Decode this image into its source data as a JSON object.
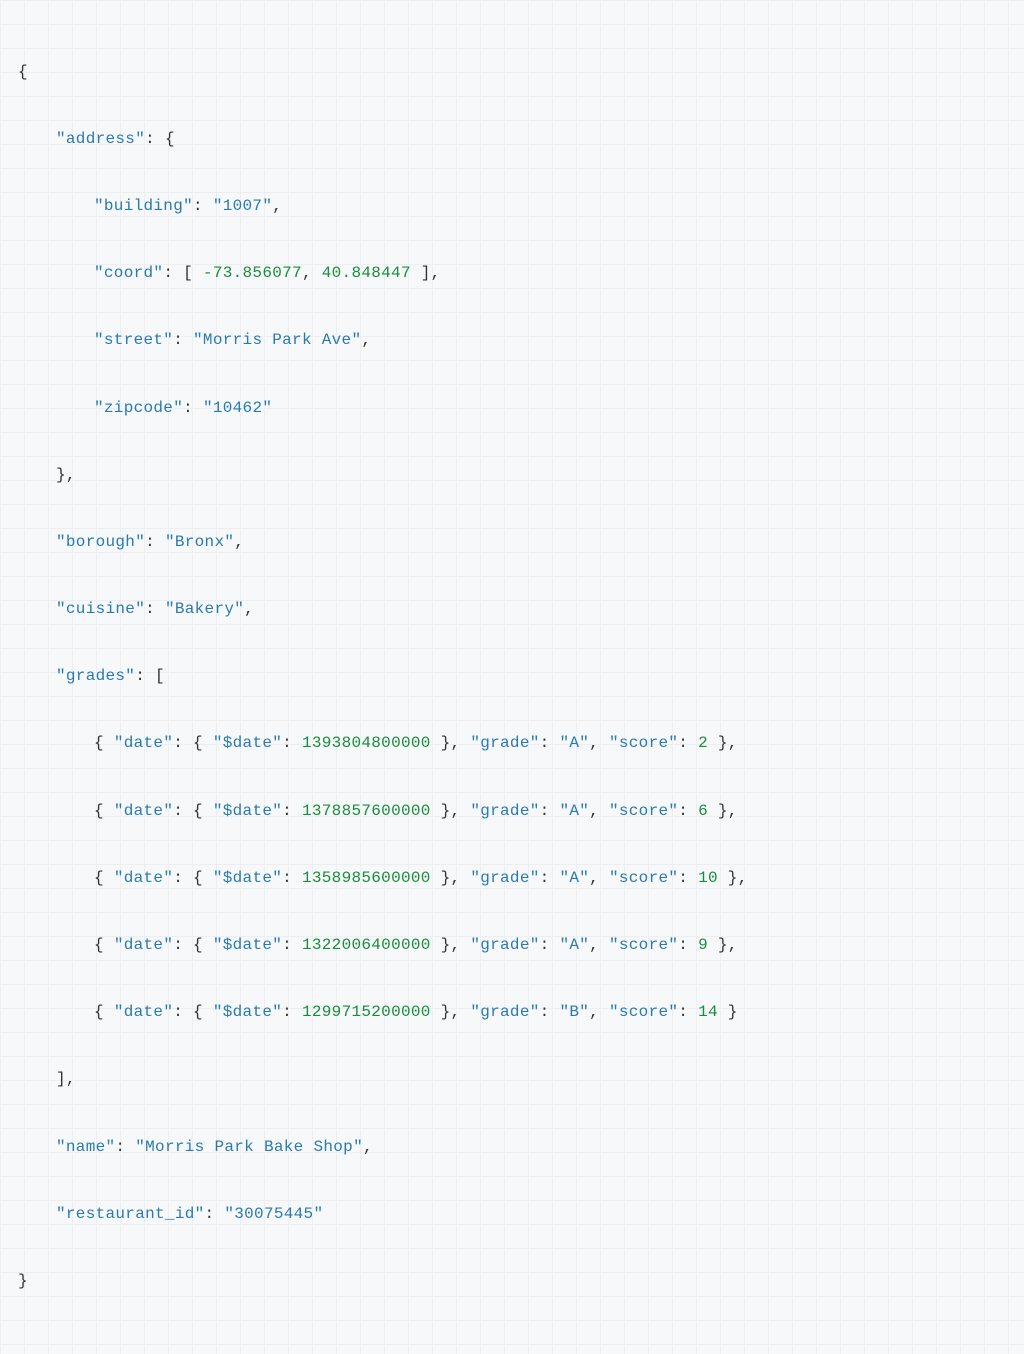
{
  "json_document": {
    "address": {
      "building": "1007",
      "coord": [
        -73.856077,
        40.848447
      ],
      "street": "Morris Park Ave",
      "zipcode": "10462"
    },
    "borough": "Bronx",
    "cuisine": "Bakery",
    "grades": [
      {
        "date": {
          "$date": 1393804800000
        },
        "grade": "A",
        "score": 2
      },
      {
        "date": {
          "$date": 1378857600000
        },
        "grade": "A",
        "score": 6
      },
      {
        "date": {
          "$date": 1358985600000
        },
        "grade": "A",
        "score": 10
      },
      {
        "date": {
          "$date": 1322006400000
        },
        "grade": "A",
        "score": 9
      },
      {
        "date": {
          "$date": 1299715200000
        },
        "grade": "B",
        "score": 14
      }
    ],
    "name": "Morris Park Bake Shop",
    "restaurant_id": "30075445"
  },
  "tokens": {
    "open_brace": "{",
    "close_brace": "}",
    "open_bracket": "[",
    "close_bracket": "]",
    "comma": ",",
    "colon": ":",
    "keys": {
      "address": "\"address\"",
      "building": "\"building\"",
      "coord": "\"coord\"",
      "street": "\"street\"",
      "zipcode": "\"zipcode\"",
      "borough": "\"borough\"",
      "cuisine": "\"cuisine\"",
      "grades": "\"grades\"",
      "date": "\"date\"",
      "dollar_date": "\"$date\"",
      "grade": "\"grade\"",
      "score": "\"score\"",
      "name": "\"name\"",
      "restaurant_id": "\"restaurant_id\""
    },
    "values": {
      "building": "\"1007\"",
      "coord0": "-73.856077",
      "coord1": "40.848447",
      "street": "\"Morris Park Ave\"",
      "zipcode": "\"10462\"",
      "borough": "\"Bronx\"",
      "cuisine": "\"Bakery\"",
      "date0": "1393804800000",
      "date1": "1378857600000",
      "date2": "1358985600000",
      "date3": "1322006400000",
      "date4": "1299715200000",
      "grade_a": "\"A\"",
      "grade_b": "\"B\"",
      "score0": "2",
      "score1": "6",
      "score2": "10",
      "score3": "9",
      "score4": "14",
      "name": "\"Morris Park Bake Shop\"",
      "restaurant_id": "\"30075445\""
    }
  }
}
